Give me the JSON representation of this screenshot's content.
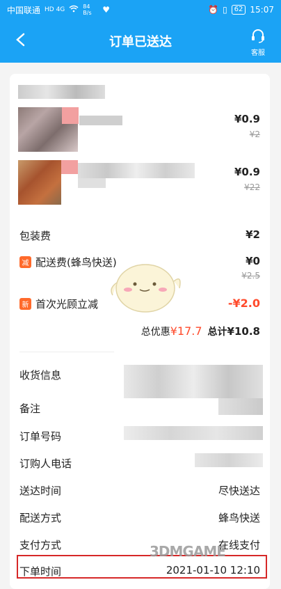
{
  "statusbar": {
    "carrier": "中国联通",
    "net": "HD 4G",
    "speed": "84 B/s",
    "battery": "62",
    "time": "15:07"
  },
  "header": {
    "title": "订单已送达",
    "service_label": "客服"
  },
  "items": [
    {
      "price": "¥0.9",
      "orig": "¥2"
    },
    {
      "price": "¥0.9",
      "orig": "¥22"
    }
  ],
  "fees": {
    "packing_label": "包装费",
    "packing_value": "¥2",
    "delivery_tag": "减",
    "delivery_label": "配送费(蜂鸟快送)",
    "delivery_value": "¥0",
    "delivery_orig": "¥2.5",
    "firstorder_tag": "新",
    "firstorder_label": "首次光顾立减",
    "firstorder_value": "-¥2.0"
  },
  "summary": {
    "discount_label": "总优惠",
    "discount_value": "¥17.7",
    "total_label": "总计",
    "total_value": "¥10.8"
  },
  "details": [
    {
      "label": "收货信息",
      "value": ""
    },
    {
      "label": "备注",
      "value": ""
    },
    {
      "label": "订单号码",
      "value": ""
    },
    {
      "label": "订购人电话",
      "value": ""
    },
    {
      "label": "送达时间",
      "value": "尽快送达"
    },
    {
      "label": "配送方式",
      "value": "蜂鸟快送"
    },
    {
      "label": "支付方式",
      "value": "在线支付"
    },
    {
      "label": "下单时间",
      "value": "2021-01-10 12:10"
    }
  ],
  "watermark": "3DMGAME"
}
